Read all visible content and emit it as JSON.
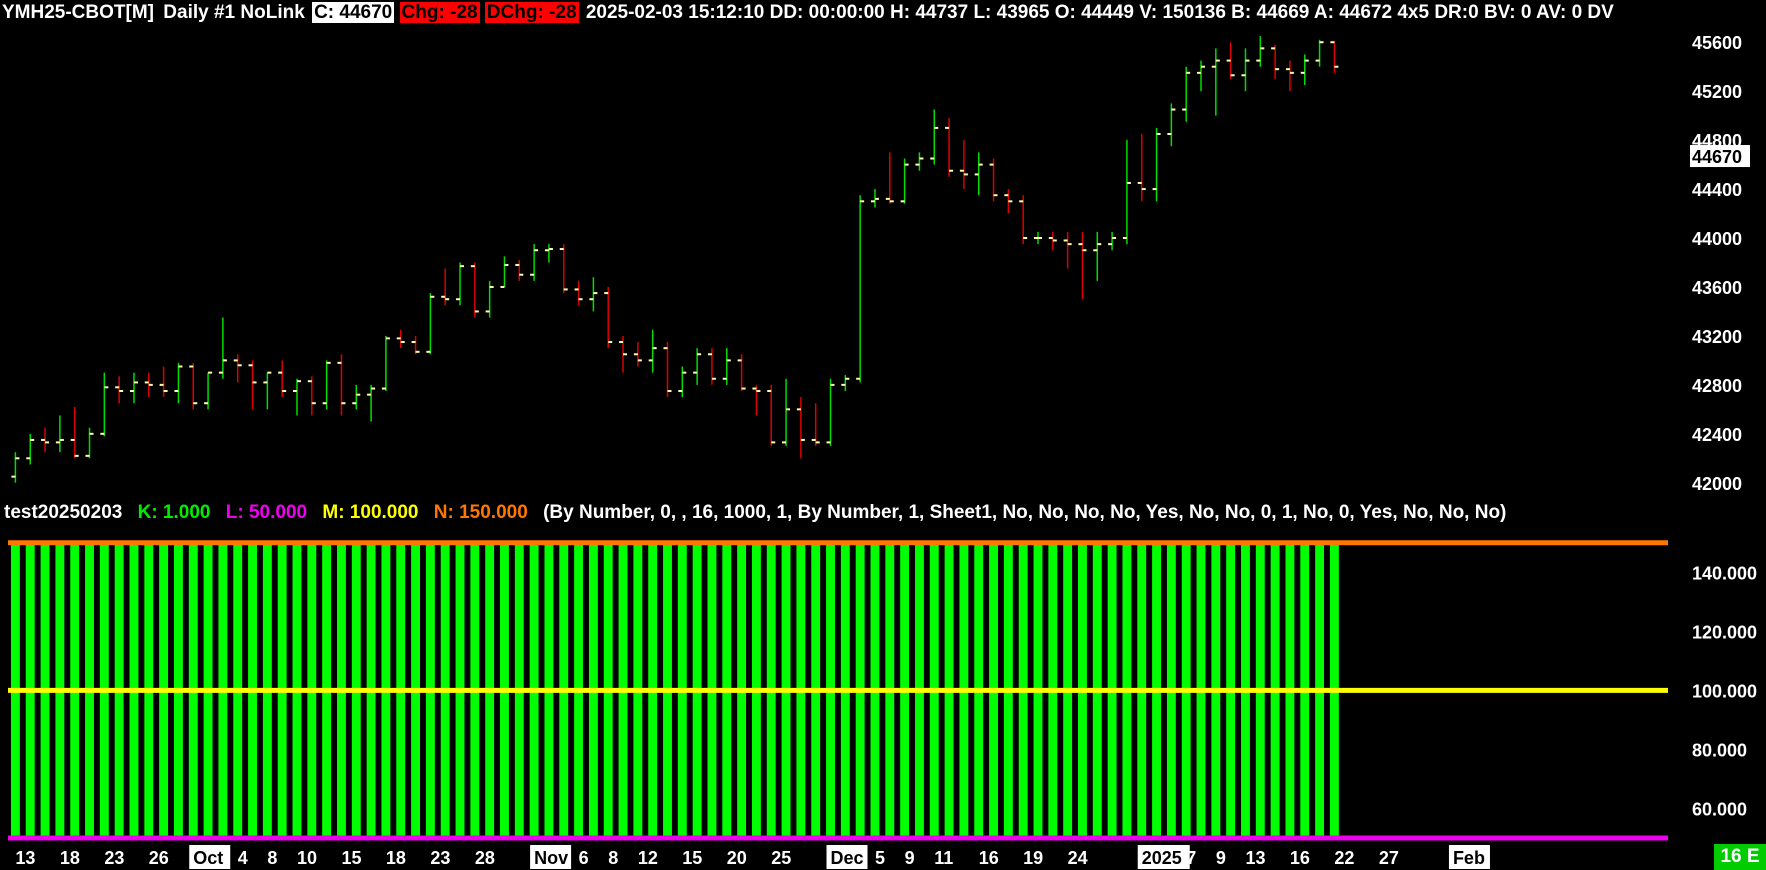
{
  "header": {
    "symbol": "YMH25-CBOT[M]",
    "chart_info": "Daily #1 NoLink",
    "close": "C: 44670",
    "chg": "Chg: -28",
    "dchg": "DChg: -28",
    "details": "2025-02-03 15:12:10 DD: 00:00:00 H: 44737 L: 43965 O: 44449 V: 150136 B: 44669 A: 44672 4x5 DR:0 BV: 0 AV: 0 DV"
  },
  "study": {
    "name": "test20250203",
    "k": "K: 1.000",
    "l": "L: 50.000",
    "m": "M: 100.000",
    "n": "N: 150.000",
    "params": "(By Number, 0, , 16, 1000, 1, By Number, 1, Sheet1, No, No, No, No, Yes, No, No, 0, 1, No, 0, Yes, No, No, No)"
  },
  "footer_badge": "16 E",
  "colors": {
    "up": "#00dd00",
    "down": "#dd0000",
    "tick": "#ffffaa",
    "k": "#00ee00",
    "l": "#ee00ee",
    "m": "#ffff00",
    "n": "#ff7700",
    "bar_fill": "#00ff00"
  },
  "chart_data": [
    {
      "type": "ohlc",
      "y_ticks": [
        42000,
        42400,
        42800,
        43200,
        43600,
        44000,
        44400,
        44800,
        45200,
        45600
      ],
      "last_price": 44670,
      "x_labels": [
        {
          "label": "13",
          "i": 0,
          "highlight": false
        },
        {
          "label": "18",
          "i": 3,
          "highlight": false
        },
        {
          "label": "23",
          "i": 6,
          "highlight": false
        },
        {
          "label": "26",
          "i": 9,
          "highlight": false
        },
        {
          "label": "Oct",
          "i": 12,
          "highlight": true
        },
        {
          "label": "4",
          "i": 15,
          "highlight": false
        },
        {
          "label": "8",
          "i": 17,
          "highlight": false
        },
        {
          "label": "10",
          "i": 19,
          "highlight": false
        },
        {
          "label": "15",
          "i": 22,
          "highlight": false
        },
        {
          "label": "18",
          "i": 25,
          "highlight": false
        },
        {
          "label": "23",
          "i": 28,
          "highlight": false
        },
        {
          "label": "28",
          "i": 31,
          "highlight": false
        },
        {
          "label": "Nov",
          "i": 35,
          "highlight": true
        },
        {
          "label": "6",
          "i": 38,
          "highlight": false
        },
        {
          "label": "8",
          "i": 40,
          "highlight": false
        },
        {
          "label": "12",
          "i": 42,
          "highlight": false
        },
        {
          "label": "15",
          "i": 45,
          "highlight": false
        },
        {
          "label": "20",
          "i": 48,
          "highlight": false
        },
        {
          "label": "25",
          "i": 51,
          "highlight": false
        },
        {
          "label": "Dec",
          "i": 55,
          "highlight": true
        },
        {
          "label": "5",
          "i": 58,
          "highlight": false
        },
        {
          "label": "9",
          "i": 60,
          "highlight": false
        },
        {
          "label": "11",
          "i": 62,
          "highlight": false
        },
        {
          "label": "16",
          "i": 65,
          "highlight": false
        },
        {
          "label": "19",
          "i": 68,
          "highlight": false
        },
        {
          "label": "24",
          "i": 71,
          "highlight": false
        },
        {
          "label": "2025",
          "i": 76,
          "highlight": true
        },
        {
          "label": "7",
          "i": 79,
          "highlight": false
        },
        {
          "label": "9",
          "i": 81,
          "highlight": false
        },
        {
          "label": "13",
          "i": 83,
          "highlight": false
        },
        {
          "label": "16",
          "i": 86,
          "highlight": false
        },
        {
          "label": "22",
          "i": 89,
          "highlight": false
        },
        {
          "label": "27",
          "i": 92,
          "highlight": false
        },
        {
          "label": "Feb",
          "i": 97,
          "highlight": true
        }
      ],
      "bars": [
        {
          "o": 42050,
          "h": 42250,
          "l": 42000,
          "c": 42200
        },
        {
          "o": 42200,
          "h": 42400,
          "l": 42150,
          "c": 42350
        },
        {
          "o": 42350,
          "h": 42450,
          "l": 42250,
          "c": 42330
        },
        {
          "o": 42330,
          "h": 42550,
          "l": 42250,
          "c": 42350
        },
        {
          "o": 42350,
          "h": 42620,
          "l": 42200,
          "c": 42220
        },
        {
          "o": 42220,
          "h": 42450,
          "l": 42200,
          "c": 42400
        },
        {
          "o": 42400,
          "h": 42900,
          "l": 42380,
          "c": 42780
        },
        {
          "o": 42780,
          "h": 42870,
          "l": 42650,
          "c": 42750
        },
        {
          "o": 42750,
          "h": 42900,
          "l": 42650,
          "c": 42820
        },
        {
          "o": 42820,
          "h": 42900,
          "l": 42700,
          "c": 42800
        },
        {
          "o": 42800,
          "h": 42950,
          "l": 42700,
          "c": 42750
        },
        {
          "o": 42750,
          "h": 42980,
          "l": 42650,
          "c": 42950
        },
        {
          "o": 42950,
          "h": 42980,
          "l": 42600,
          "c": 42650
        },
        {
          "o": 42650,
          "h": 42900,
          "l": 42600,
          "c": 42900
        },
        {
          "o": 42900,
          "h": 43350,
          "l": 42850,
          "c": 43000
        },
        {
          "o": 43000,
          "h": 43050,
          "l": 42820,
          "c": 42960
        },
        {
          "o": 42960,
          "h": 43000,
          "l": 42600,
          "c": 42820
        },
        {
          "o": 42820,
          "h": 42900,
          "l": 42600,
          "c": 42900
        },
        {
          "o": 42900,
          "h": 43000,
          "l": 42700,
          "c": 42750
        },
        {
          "o": 42750,
          "h": 42850,
          "l": 42550,
          "c": 42830
        },
        {
          "o": 42830,
          "h": 42870,
          "l": 42550,
          "c": 42650
        },
        {
          "o": 42650,
          "h": 43000,
          "l": 42600,
          "c": 42980
        },
        {
          "o": 42980,
          "h": 43050,
          "l": 42550,
          "c": 42650
        },
        {
          "o": 42650,
          "h": 42800,
          "l": 42600,
          "c": 42720
        },
        {
          "o": 42720,
          "h": 42800,
          "l": 42500,
          "c": 42770
        },
        {
          "o": 42770,
          "h": 43200,
          "l": 42750,
          "c": 43180
        },
        {
          "o": 43180,
          "h": 43250,
          "l": 43100,
          "c": 43150
        },
        {
          "o": 43150,
          "h": 43200,
          "l": 43050,
          "c": 43070
        },
        {
          "o": 43070,
          "h": 43550,
          "l": 43050,
          "c": 43520
        },
        {
          "o": 43520,
          "h": 43750,
          "l": 43450,
          "c": 43500
        },
        {
          "o": 43500,
          "h": 43800,
          "l": 43450,
          "c": 43770
        },
        {
          "o": 43770,
          "h": 43800,
          "l": 43350,
          "c": 43400
        },
        {
          "o": 43400,
          "h": 43650,
          "l": 43350,
          "c": 43600
        },
        {
          "o": 43600,
          "h": 43850,
          "l": 43600,
          "c": 43780
        },
        {
          "o": 43780,
          "h": 43820,
          "l": 43650,
          "c": 43700
        },
        {
          "o": 43700,
          "h": 43950,
          "l": 43650,
          "c": 43900
        },
        {
          "o": 43900,
          "h": 43950,
          "l": 43800,
          "c": 43910
        },
        {
          "o": 43910,
          "h": 43950,
          "l": 43550,
          "c": 43580
        },
        {
          "o": 43580,
          "h": 43650,
          "l": 43450,
          "c": 43500
        },
        {
          "o": 43500,
          "h": 43680,
          "l": 43400,
          "c": 43550
        },
        {
          "o": 43550,
          "h": 43600,
          "l": 43100,
          "c": 43150
        },
        {
          "o": 43150,
          "h": 43200,
          "l": 42900,
          "c": 43050
        },
        {
          "o": 43050,
          "h": 43150,
          "l": 42950,
          "c": 43000
        },
        {
          "o": 43000,
          "h": 43250,
          "l": 42900,
          "c": 43100
        },
        {
          "o": 43100,
          "h": 43150,
          "l": 42700,
          "c": 42750
        },
        {
          "o": 42750,
          "h": 42950,
          "l": 42700,
          "c": 42900
        },
        {
          "o": 42900,
          "h": 43100,
          "l": 42800,
          "c": 43050
        },
        {
          "o": 43050,
          "h": 43100,
          "l": 42800,
          "c": 42850
        },
        {
          "o": 42850,
          "h": 43100,
          "l": 42800,
          "c": 43000
        },
        {
          "o": 43000,
          "h": 43050,
          "l": 42750,
          "c": 42770
        },
        {
          "o": 42770,
          "h": 42800,
          "l": 42550,
          "c": 42750
        },
        {
          "o": 42750,
          "h": 42800,
          "l": 42300,
          "c": 42330
        },
        {
          "o": 42330,
          "h": 42850,
          "l": 42300,
          "c": 42600
        },
        {
          "o": 42600,
          "h": 42700,
          "l": 42200,
          "c": 42350
        },
        {
          "o": 42350,
          "h": 42650,
          "l": 42300,
          "c": 42330
        },
        {
          "o": 42330,
          "h": 42850,
          "l": 42300,
          "c": 42800
        },
        {
          "o": 42800,
          "h": 42880,
          "l": 42750,
          "c": 42850
        },
        {
          "o": 42850,
          "h": 44350,
          "l": 42820,
          "c": 44300
        },
        {
          "o": 44300,
          "h": 44400,
          "l": 44250,
          "c": 44320
        },
        {
          "o": 44320,
          "h": 44700,
          "l": 44280,
          "c": 44300
        },
        {
          "o": 44300,
          "h": 44650,
          "l": 44280,
          "c": 44600
        },
        {
          "o": 44600,
          "h": 44700,
          "l": 44550,
          "c": 44650
        },
        {
          "o": 44650,
          "h": 45050,
          "l": 44600,
          "c": 44900
        },
        {
          "o": 44900,
          "h": 44980,
          "l": 44500,
          "c": 44550
        },
        {
          "o": 44550,
          "h": 44800,
          "l": 44400,
          "c": 44520
        },
        {
          "o": 44520,
          "h": 44700,
          "l": 44350,
          "c": 44600
        },
        {
          "o": 44600,
          "h": 44650,
          "l": 44300,
          "c": 44350
        },
        {
          "o": 44350,
          "h": 44400,
          "l": 44200,
          "c": 44300
        },
        {
          "o": 44300,
          "h": 44350,
          "l": 43950,
          "c": 44000
        },
        {
          "o": 44000,
          "h": 44050,
          "l": 43950,
          "c": 44000
        },
        {
          "o": 44000,
          "h": 44050,
          "l": 43900,
          "c": 43980
        },
        {
          "o": 43980,
          "h": 44050,
          "l": 43750,
          "c": 43950
        },
        {
          "o": 43950,
          "h": 44050,
          "l": 43500,
          "c": 43900
        },
        {
          "o": 43900,
          "h": 44050,
          "l": 43650,
          "c": 43950
        },
        {
          "o": 43950,
          "h": 44050,
          "l": 43900,
          "c": 44000
        },
        {
          "o": 44000,
          "h": 44800,
          "l": 43950,
          "c": 44450
        },
        {
          "o": 44450,
          "h": 44850,
          "l": 44300,
          "c": 44400
        },
        {
          "o": 44400,
          "h": 44900,
          "l": 44300,
          "c": 44850
        },
        {
          "o": 44850,
          "h": 45100,
          "l": 44750,
          "c": 45050
        },
        {
          "o": 45050,
          "h": 45400,
          "l": 44950,
          "c": 45350
        },
        {
          "o": 45350,
          "h": 45450,
          "l": 45200,
          "c": 45400
        },
        {
          "o": 45400,
          "h": 45550,
          "l": 45000,
          "c": 45450
        },
        {
          "o": 45450,
          "h": 45600,
          "l": 45300,
          "c": 45330
        },
        {
          "o": 45330,
          "h": 45550,
          "l": 45200,
          "c": 45450
        },
        {
          "o": 45450,
          "h": 45650,
          "l": 45400,
          "c": 45550
        },
        {
          "o": 45550,
          "h": 45580,
          "l": 45300,
          "c": 45380
        },
        {
          "o": 45380,
          "h": 45450,
          "l": 45200,
          "c": 45350
        },
        {
          "o": 45350,
          "h": 45500,
          "l": 45250,
          "c": 45450
        },
        {
          "o": 45450,
          "h": 45620,
          "l": 45400,
          "c": 45600
        },
        {
          "o": 45600,
          "h": 45610,
          "l": 45350,
          "c": 45400
        }
      ]
    },
    {
      "type": "bar",
      "y_ticks": [
        60,
        80,
        100,
        120,
        140
      ],
      "ylim": [
        50,
        155
      ],
      "bar_value": 150,
      "lines": {
        "K": 1,
        "L": 50,
        "M": 100,
        "N": 150
      }
    }
  ]
}
